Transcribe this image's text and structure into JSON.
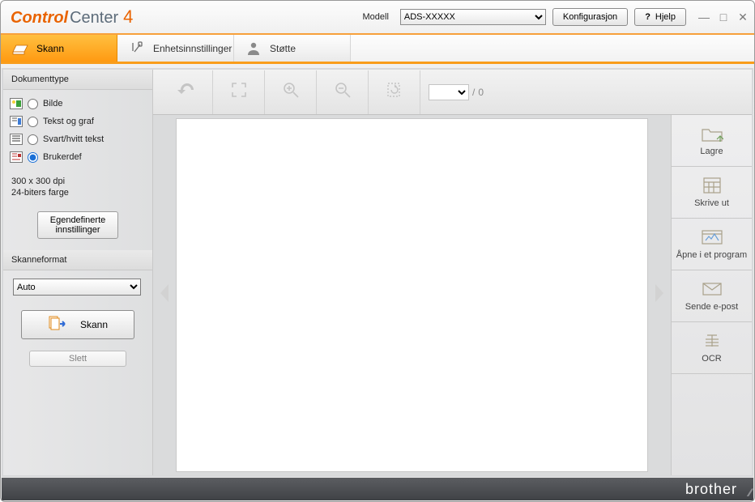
{
  "header": {
    "title_main": "Control",
    "title_sub": " Center",
    "title_num": "4",
    "model_label": "Modell",
    "model_value": "ADS-XXXXX",
    "config_btn": "Konfigurasjon",
    "help_btn": "Hjelp"
  },
  "tabs": {
    "scan": "Skann",
    "device": "Enhetsinnstillinger",
    "support": "Støtte"
  },
  "sidebar": {
    "doctype_header": "Dokumenttype",
    "radios": {
      "image": "Bilde",
      "text": "Tekst og graf",
      "bw": "Svart/hvitt tekst",
      "custom": "Brukerdef"
    },
    "dpi_line1": "300 x 300 dpi",
    "dpi_line2": "24-biters farge",
    "custom_btn": "Egendefinerte innstillinger",
    "format_header": "Skanneformat",
    "format_value": "Auto",
    "scan_btn": "Skann",
    "delete_btn": "Slett"
  },
  "toolbar": {
    "page_total": "0"
  },
  "actions": {
    "save": "Lagre",
    "print": "Skrive ut",
    "open": "Åpne i et program",
    "email": "Sende e-post",
    "ocr": "OCR"
  },
  "footer": {
    "brand": "brother"
  }
}
